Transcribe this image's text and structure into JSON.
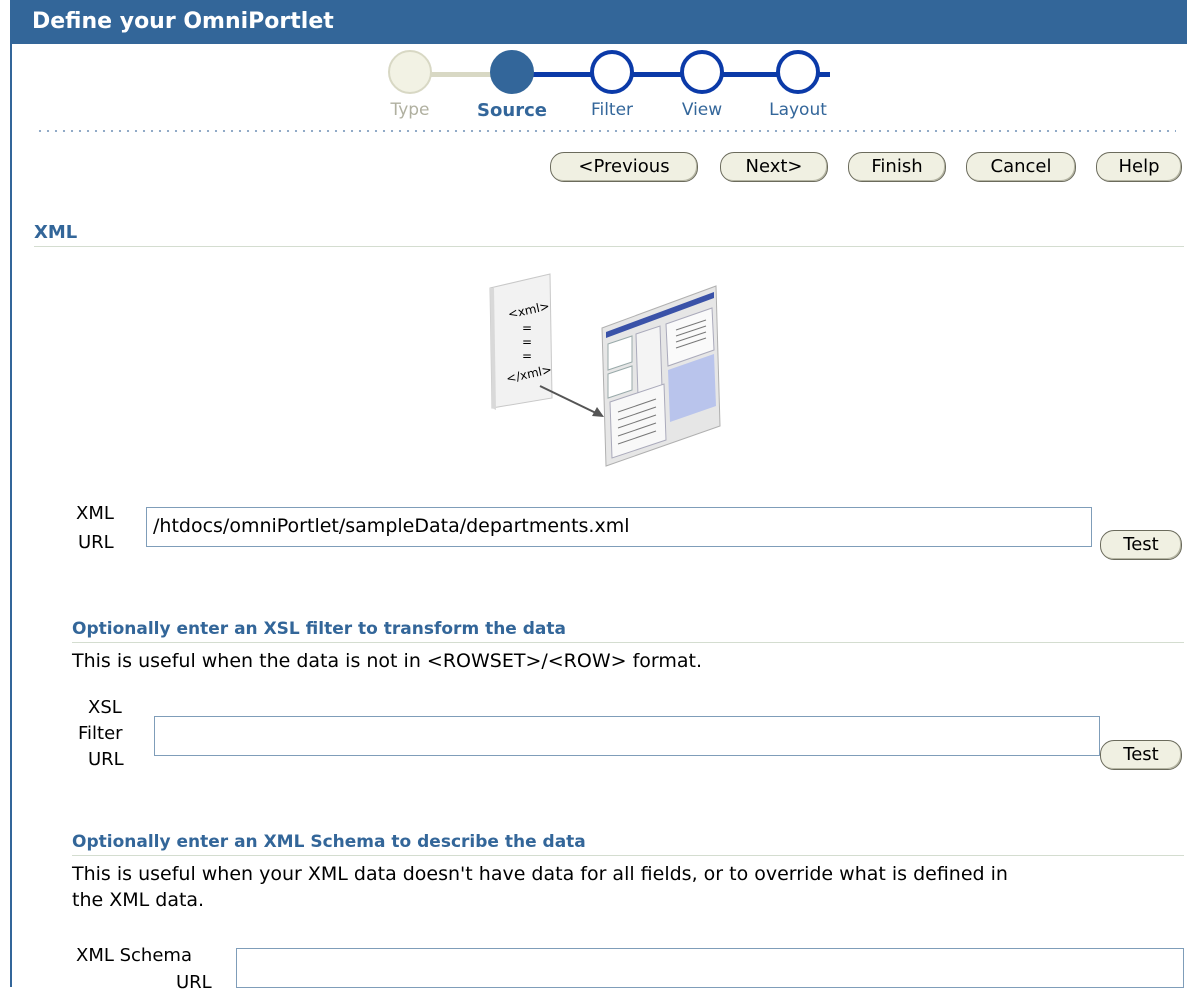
{
  "header": {
    "title": "Define your OmniPortlet"
  },
  "train": {
    "steps": [
      {
        "label": "Type",
        "state": "visited"
      },
      {
        "label": "Source",
        "state": "current"
      },
      {
        "label": "Filter",
        "state": "next"
      },
      {
        "label": "View",
        "state": "next"
      },
      {
        "label": "Layout",
        "state": "next"
      }
    ]
  },
  "toolbar": {
    "previous_label": "<Previous",
    "next_label": "Next>",
    "finish_label": "Finish",
    "cancel_label": "Cancel",
    "help_label": "Help"
  },
  "xml_section": {
    "title": "XML",
    "illustration": {
      "tag_open": "<xml>",
      "tag_close": "</xml>"
    },
    "xml_url_label_line1": "XML",
    "xml_url_label_line2": "URL",
    "xml_url_value": "/htdocs/omniPortlet/sampleData/departments.xml",
    "test_label": "Test"
  },
  "xsl_section": {
    "title": "Optionally enter an XSL filter to transform the data",
    "help": "This is useful when the data is not in <ROWSET>/<ROW> format.",
    "label_line1": "XSL",
    "label_line2": "Filter",
    "label_line3": "URL",
    "value": "",
    "test_label": "Test"
  },
  "schema_section": {
    "title": "Optionally enter an XML Schema to describe the data",
    "help_line1": "This is useful when your XML data doesn't have data for all fields, or to override what is defined in",
    "help_line2": "the XML data.",
    "label_line1": "XML Schema",
    "label_line2": "URL",
    "value": ""
  },
  "colors": {
    "header": "#336699",
    "accent": "#33669a",
    "train_next": "#0b3aa8"
  }
}
